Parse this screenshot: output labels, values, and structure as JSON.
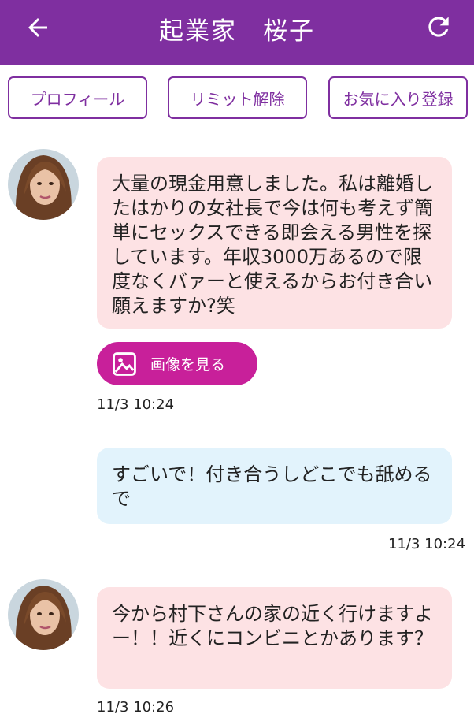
{
  "header": {
    "title": "起業家　桜子",
    "back_icon": "arrow-left-icon",
    "refresh_icon": "refresh-icon",
    "color": "#7f2fa0"
  },
  "actions": {
    "profile": "プロフィール",
    "limit_release": "リミット解除",
    "favorite_register": "お気に入り登録"
  },
  "messages": [
    {
      "from": "them",
      "text": "大量の現金用意しました。私は離婚したはかりの女社長で今は何も考えず簡単にセックスできる即会える男性を探しています。年収3000万あるので限度なくバァーと使えるからお付き合い願えますか?笑",
      "image_button": "画像を見る",
      "time": "11/3 10:24"
    },
    {
      "from": "me",
      "text": "すごいで！付き合うしどこでも舐めるで",
      "time": "11/3 10:24"
    },
    {
      "from": "them",
      "text": "今から村下さんの家の近く行けますよー！！近くにコンビニとかあります？",
      "time": "11/3 10:26"
    }
  ],
  "colors": {
    "them_bubble": "#fde2e4",
    "me_bubble": "#e2f3fc",
    "accent": "#c8209a"
  }
}
